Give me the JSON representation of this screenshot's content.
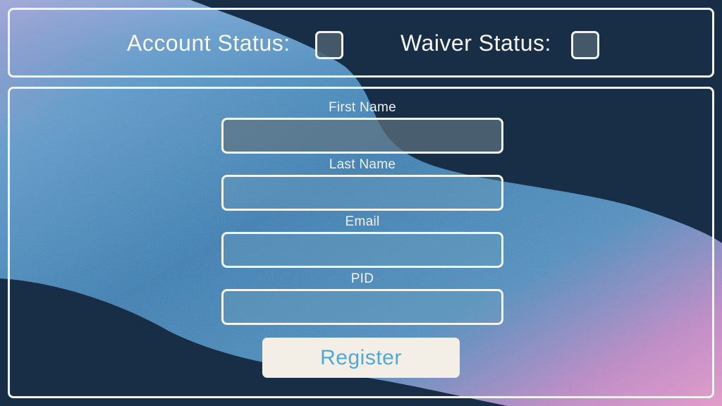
{
  "status": {
    "account_label": "Account Status:",
    "waiver_label": "Waiver Status:",
    "account_checked": false,
    "waiver_checked": false
  },
  "form": {
    "fields": [
      {
        "label": "First Name",
        "value": ""
      },
      {
        "label": "Last Name",
        "value": ""
      },
      {
        "label": "Email",
        "value": ""
      },
      {
        "label": "PID",
        "value": ""
      }
    ],
    "submit_label": "Register"
  },
  "colors": {
    "background": "#172e46",
    "wave_blue": "#3a86b8",
    "wave_pink": "#d890c8",
    "border": "#f2f2f2",
    "button_bg": "#f3efe7",
    "button_text": "#4fa8d8"
  }
}
